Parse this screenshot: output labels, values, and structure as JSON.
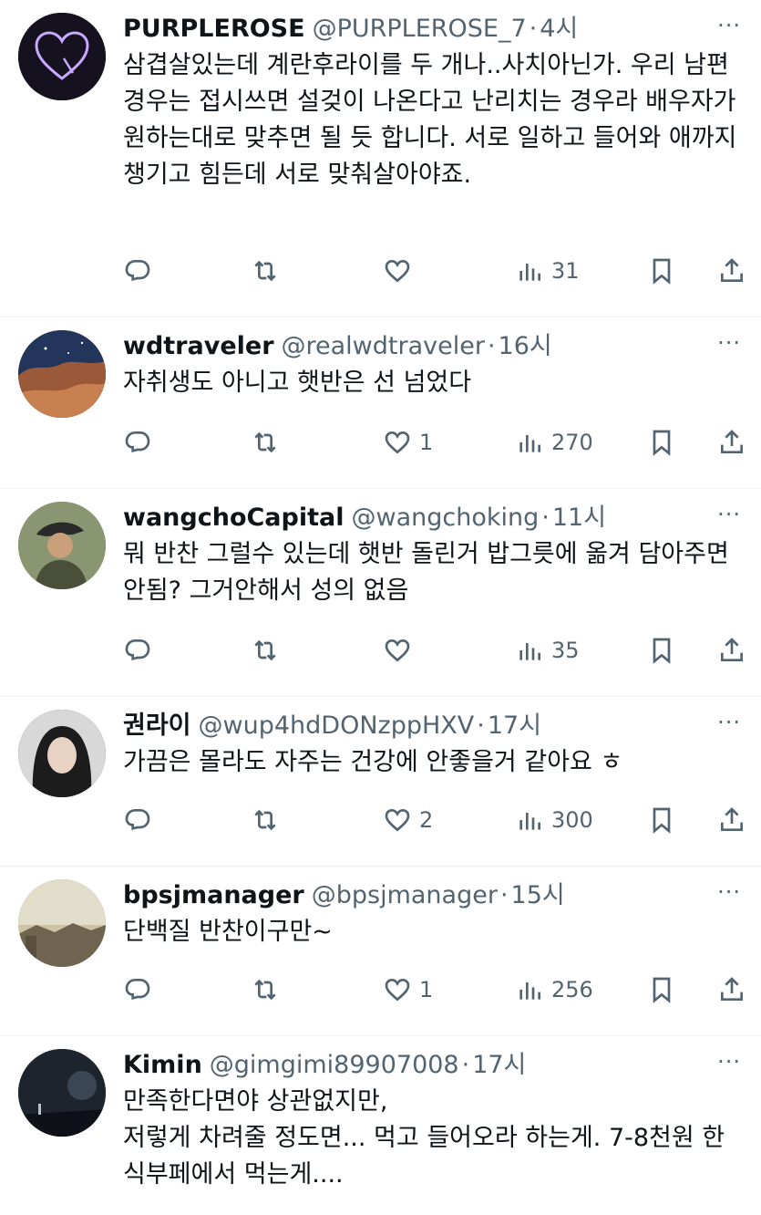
{
  "tweets": [
    {
      "name": "PURPLEROSE",
      "handle": "@PURPLEROSE_7",
      "time": "4시",
      "text": "삼겹살있는데 계란후라이를 두 개나..사치아닌가. 우리 남편 경우는 접시쓰면 설겆이 나온다고 난리치는 경우라 배우자가 원하는대로 맞추면 될 듯 합니다. 서로 일하고 들어와 애까지 챙기고 힘든데 서로 맞춰살아야죠.",
      "reply": "",
      "retweet": "",
      "like": "",
      "views": "31",
      "avatar_color": "#1a1426"
    },
    {
      "name": "wdtraveler",
      "handle": "@realwdtraveler",
      "time": "16시",
      "text": "자취생도 아니고 햇반은 선 넘었다",
      "reply": "",
      "retweet": "",
      "like": "1",
      "views": "270",
      "avatar_color": "#6b4a3a"
    },
    {
      "name": "wangchoCapital",
      "handle": "@wangchoking",
      "time": "11시",
      "text": "뭐 반찬 그럴수 있는데 햇반 돌린거 밥그릇에 옮겨 담아주면 안됨? 그거안해서 성의 없음",
      "reply": "",
      "retweet": "",
      "like": "",
      "views": "35",
      "avatar_color": "#6e7a5c"
    },
    {
      "name": "권라이",
      "handle": "@wup4hdDONzppHXV",
      "time": "17시",
      "text": "가끔은 몰라도 자주는 건강에 안좋을거 같아요 ㅎ",
      "reply": "",
      "retweet": "",
      "like": "2",
      "views": "300",
      "avatar_color": "#2b2b2b"
    },
    {
      "name": "bpsjmanager",
      "handle": "@bpsjmanager",
      "time": "15시",
      "text": "단백질 반찬이구만~",
      "reply": "",
      "retweet": "",
      "like": "1",
      "views": "256",
      "avatar_color": "#9a8f7c"
    },
    {
      "name": "Kimin",
      "handle": "@gimgimi89907008",
      "time": "17시",
      "text": "만족한다면야 상관없지만,\n저렇게 차려줄 정도면... 먹고 들어오라 하는게. 7-8천원 한식부페에서 먹는게....",
      "reply": "",
      "retweet": "",
      "like": "",
      "views": "",
      "avatar_color": "#1e2530"
    }
  ],
  "more_label": "···"
}
